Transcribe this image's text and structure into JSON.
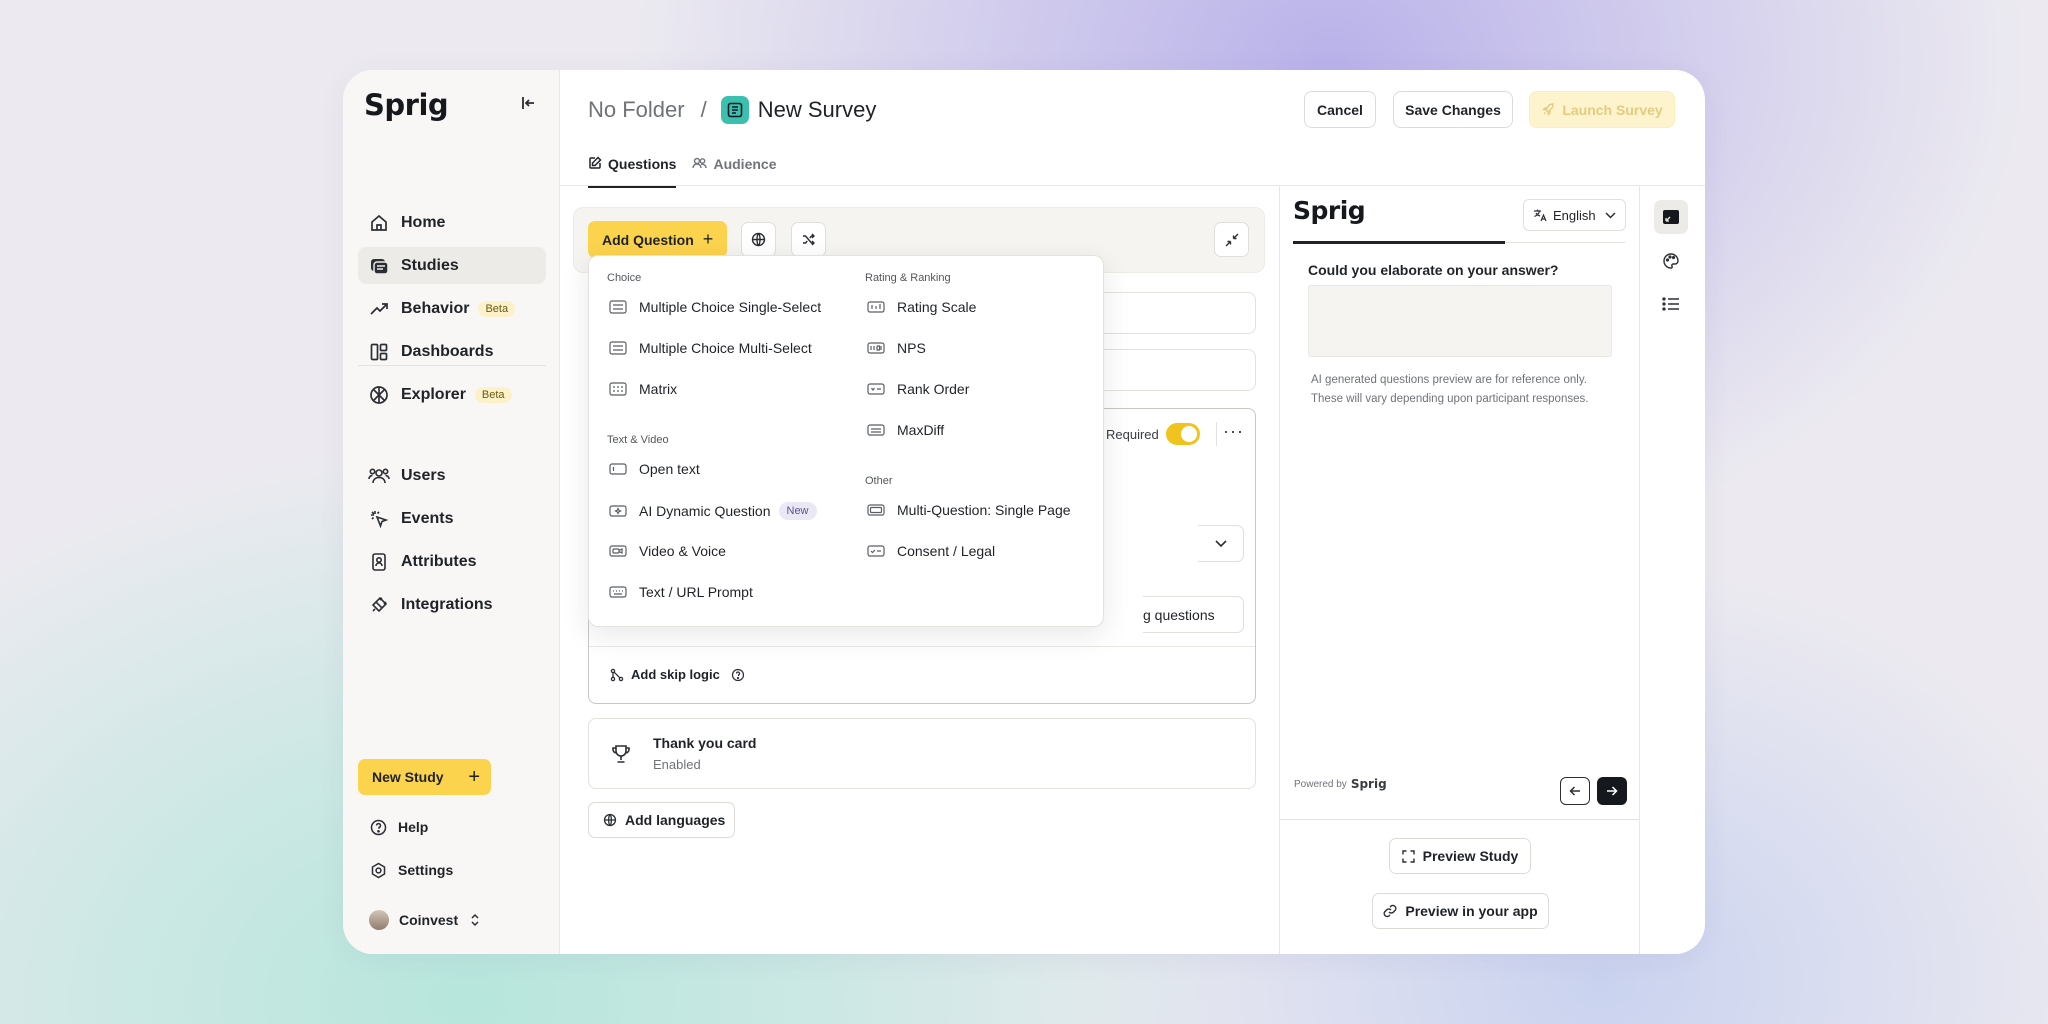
{
  "sidebar": {
    "logo": "Sprig",
    "items": [
      {
        "label": "Home"
      },
      {
        "label": "Studies"
      },
      {
        "label": "Behavior",
        "badge": "Beta"
      },
      {
        "label": "Dashboards"
      },
      {
        "label": "Explorer",
        "badge": "Beta"
      },
      {
        "label": "Users"
      },
      {
        "label": "Events"
      },
      {
        "label": "Attributes"
      },
      {
        "label": "Integrations"
      }
    ],
    "new_study": "New Study",
    "help": "Help",
    "settings": "Settings",
    "workspace": "Coinvest"
  },
  "header": {
    "folder": "No Folder",
    "separator": "/",
    "title": "New Survey",
    "cancel": "Cancel",
    "save": "Save Changes",
    "launch": "Launch Survey"
  },
  "tabs": [
    {
      "label": "Questions"
    },
    {
      "label": "Audience"
    }
  ],
  "editor": {
    "add_question": "Add Question",
    "required_label": "Required",
    "required_on": true,
    "skip_fragment": "g questions",
    "add_skip_logic": "Add skip logic",
    "thank_you": {
      "title": "Thank you card",
      "status": "Enabled"
    },
    "add_languages": "Add languages"
  },
  "dropdown": {
    "groups": {
      "choice": "Choice",
      "text_video": "Text & Video",
      "rating": "Rating & Ranking",
      "other": "Other"
    },
    "choice": [
      "Multiple Choice Single-Select",
      "Multiple Choice Multi-Select",
      "Matrix"
    ],
    "text_video": [
      "Open text",
      "AI Dynamic Question",
      "Video & Voice",
      "Text / URL Prompt"
    ],
    "ai_badge": "New",
    "rating": [
      "Rating Scale",
      "NPS",
      "Rank Order",
      "MaxDiff"
    ],
    "other": [
      "Multi-Question: Single Page",
      "Consent / Legal"
    ]
  },
  "preview": {
    "logo": "Sprig",
    "language": "English",
    "question": "Could you elaborate on your answer?",
    "note": "AI generated questions preview are for reference only. These will vary depending upon participant responses.",
    "powered_by": "Powered by",
    "powered_brand": "Sprig",
    "preview_study": "Preview Study",
    "preview_app": "Preview in your app"
  },
  "colors": {
    "accent": "#fcd34d",
    "toggle": "#f1c31e",
    "survey_icon": "#3bbfae"
  }
}
